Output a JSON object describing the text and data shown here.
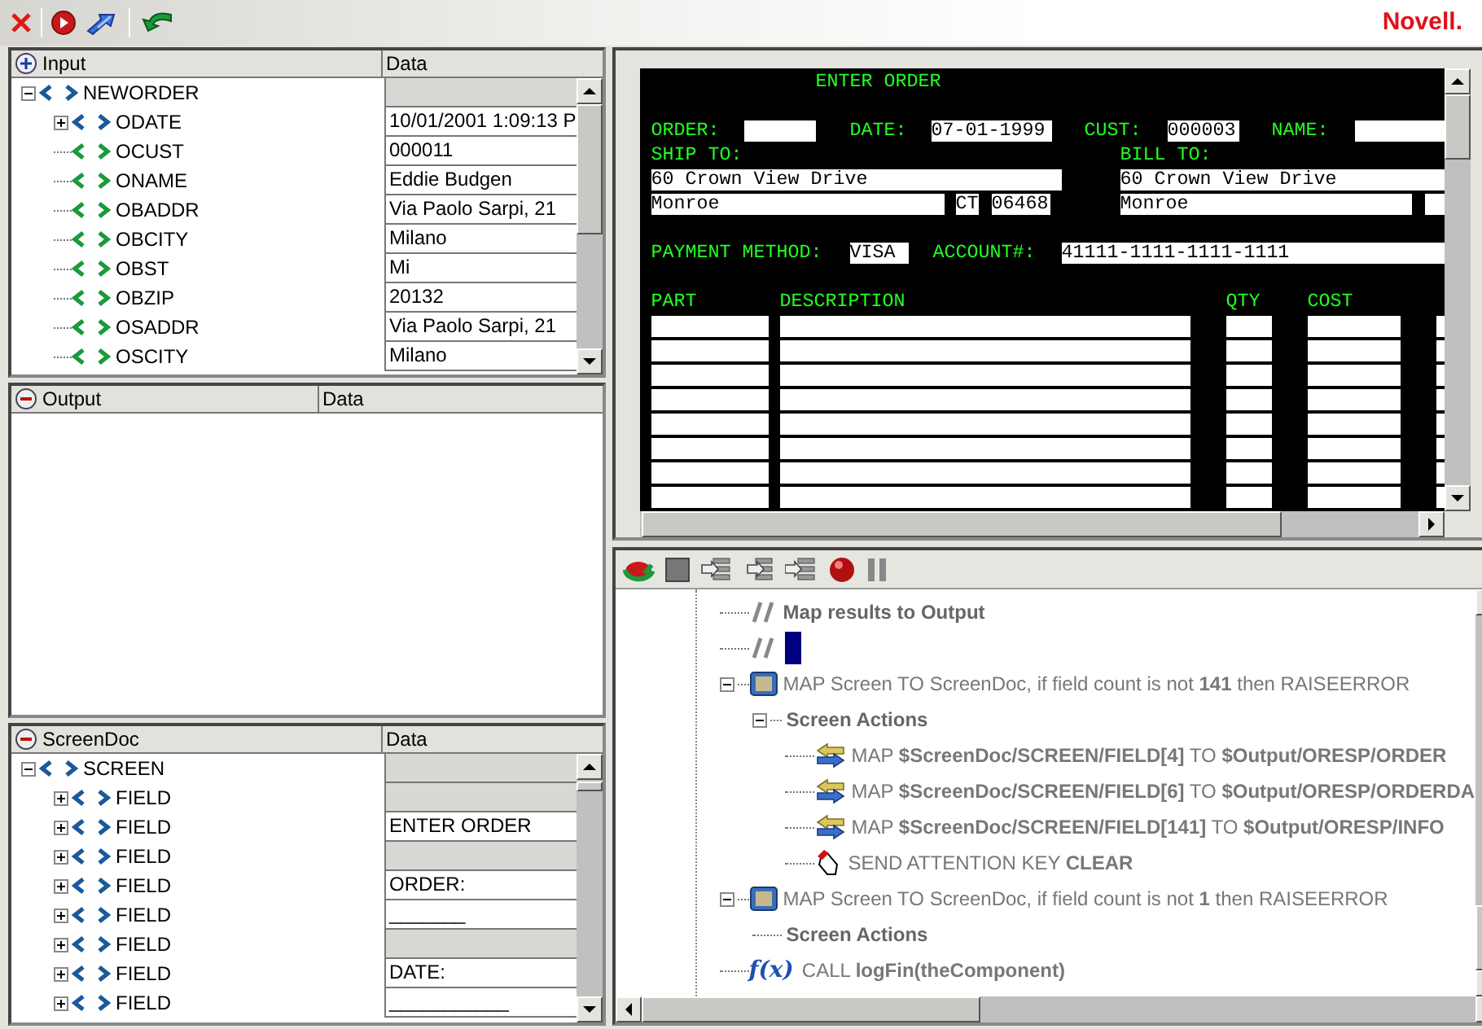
{
  "toolbar": {
    "logo": "Novell."
  },
  "panels": [
    {
      "kind": "input",
      "title": "Input",
      "data_header": "Data",
      "tree": [
        {
          "name": "NEWORDER",
          "expanded": true,
          "children": [
            {
              "name": "ODATE",
              "expanded": false,
              "data": "10/01/2001 1:09:13 P"
            },
            {
              "name": "OCUST",
              "data": "000011"
            },
            {
              "name": "ONAME",
              "data": "Eddie Budgen"
            },
            {
              "name": "OBADDR",
              "data": "Via Paolo Sarpi, 21"
            },
            {
              "name": "OBCITY",
              "data": "Milano"
            },
            {
              "name": "OBST",
              "data": "Mi"
            },
            {
              "name": "OBZIP",
              "data": "20132"
            },
            {
              "name": "OSADDR",
              "data": "Via Paolo Sarpi, 21"
            },
            {
              "name": "OSCITY",
              "data": "Milano"
            }
          ]
        }
      ]
    },
    {
      "kind": "output",
      "title": "Output",
      "data_header": "Data"
    },
    {
      "kind": "output",
      "title": "ScreenDoc",
      "data_header": "Data",
      "tree": [
        {
          "name": "SCREEN",
          "expanded": true,
          "children": [
            {
              "name": "FIELD",
              "expanded": false
            },
            {
              "name": "FIELD",
              "expanded": false,
              "data": "ENTER ORDER"
            },
            {
              "name": "FIELD",
              "expanded": false
            },
            {
              "name": "FIELD",
              "expanded": false,
              "data": "ORDER:"
            },
            {
              "name": "FIELD",
              "expanded": false,
              "data": "_______"
            },
            {
              "name": "FIELD",
              "expanded": false
            },
            {
              "name": "FIELD",
              "expanded": false,
              "data": "DATE:"
            },
            {
              "name": "FIELD",
              "expanded": false,
              "data": "___________"
            }
          ]
        }
      ]
    }
  ],
  "terminal": {
    "items": [
      {
        "kind": "label",
        "text": "ENTER ORDER"
      },
      {
        "kind": "label",
        "text": "ORDER:"
      },
      {
        "kind": "field"
      },
      {
        "kind": "label",
        "text": "DATE:"
      },
      {
        "kind": "field",
        "text": "07-01-1999"
      },
      {
        "kind": "label",
        "text": "CUST:"
      },
      {
        "kind": "field",
        "text": "000003"
      },
      {
        "kind": "label",
        "text": "NAME:"
      },
      {
        "kind": "field"
      },
      {
        "kind": "label",
        "text": "SHIP TO:"
      },
      {
        "kind": "label",
        "text": "BILL TO:"
      },
      {
        "kind": "field",
        "text": "60 Crown View Drive"
      },
      {
        "kind": "field",
        "text": "60 Crown View Drive"
      },
      {
        "kind": "field",
        "text": "Monroe"
      },
      {
        "kind": "field",
        "text": "CT"
      },
      {
        "kind": "field",
        "text": "06468"
      },
      {
        "kind": "field",
        "text": "Monroe"
      },
      {
        "kind": "field"
      },
      {
        "kind": "label",
        "text": "PAYMENT METHOD:"
      },
      {
        "kind": "field",
        "text": "VISA"
      },
      {
        "kind": "label",
        "text": "ACCOUNT#:"
      },
      {
        "kind": "field",
        "text": "41111-1111-1111-1111"
      },
      {
        "kind": "label",
        "text": "PART"
      },
      {
        "kind": "label",
        "text": "DESCRIPTION"
      },
      {
        "kind": "label",
        "text": "QTY"
      },
      {
        "kind": "label",
        "text": "COST"
      }
    ],
    "order_lines": [
      {
        "kind": "blank"
      },
      {
        "kind": "blank"
      },
      {
        "kind": "blank"
      },
      {
        "kind": "blank"
      },
      {
        "kind": "blank"
      },
      {
        "kind": "blank"
      },
      {
        "kind": "blank"
      },
      {
        "kind": "blank"
      }
    ]
  },
  "actions": [
    {
      "kind": "comment",
      "text": "Map results to Output",
      "selected": false
    },
    {
      "kind": "comment",
      "selected": true
    },
    {
      "kind": "map_screen",
      "text": "MAP Screen TO ScreenDoc, if field count is not **141** then RAISEERROR",
      "expanded": true,
      "children": [
        {
          "kind": "group",
          "text": "Screen Actions",
          "expanded": true,
          "children": [
            {
              "kind": "map_field",
              "text": "MAP **$ScreenDoc/SCREEN/FIELD[4]** TO **$Output/ORESP/ORDER**"
            },
            {
              "kind": "map_field",
              "text": "MAP **$ScreenDoc/SCREEN/FIELD[6]** TO **$Output/ORESP/ORDERDA**"
            },
            {
              "kind": "map_field",
              "text": "MAP **$ScreenDoc/SCREEN/FIELD[141]** TO **$Output/ORESP/INFO**"
            },
            {
              "kind": "send_key",
              "text": "SEND ATTENTION KEY **CLEAR**"
            }
          ]
        }
      ]
    },
    {
      "kind": "map_screen",
      "text": "MAP Screen TO ScreenDoc, if field count is not **1** then RAISEERROR",
      "expanded": true,
      "children": [
        {
          "kind": "group",
          "text": "Screen Actions"
        }
      ]
    },
    {
      "kind": "call",
      "icon_text": "f(x)",
      "text": "CALL **logFin(theComponent)**"
    }
  ]
}
